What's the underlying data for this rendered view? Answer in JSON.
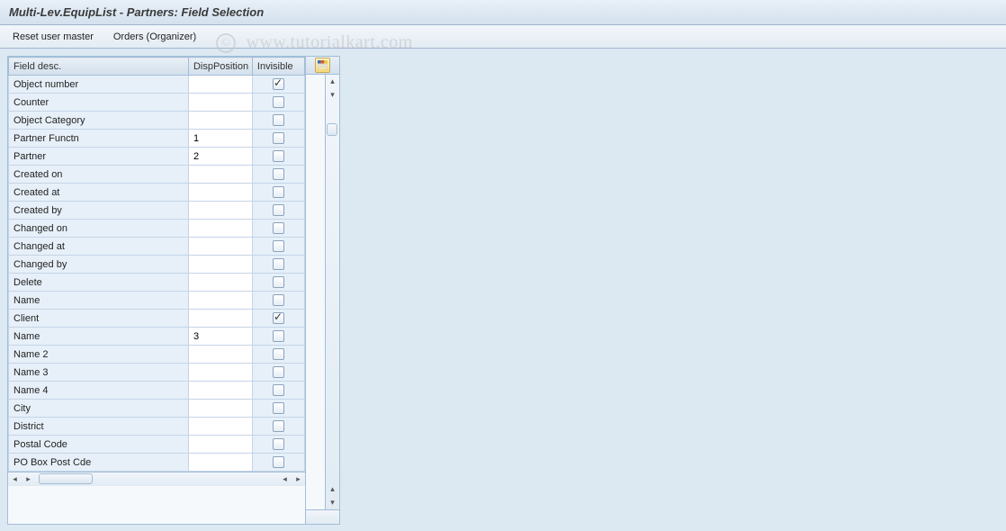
{
  "header": {
    "title": "Multi-Lev.EquipList - Partners: Field Selection"
  },
  "toolbar": {
    "reset_label": "Reset user master",
    "orders_label": "Orders (Organizer)"
  },
  "watermark": {
    "symbol": "©",
    "text": "www.tutorialkart.com"
  },
  "table": {
    "columns": {
      "field_desc": "Field desc.",
      "disp_position": "DispPosition",
      "invisible": "Invisible"
    },
    "rows": [
      {
        "field": "Object number",
        "disp": "",
        "invisible": true
      },
      {
        "field": "Counter",
        "disp": "",
        "invisible": false
      },
      {
        "field": "Object Category",
        "disp": "",
        "invisible": false
      },
      {
        "field": "Partner Functn",
        "disp": "1",
        "invisible": false
      },
      {
        "field": "Partner",
        "disp": "2",
        "invisible": false
      },
      {
        "field": "Created on",
        "disp": "",
        "invisible": false
      },
      {
        "field": "Created at",
        "disp": "",
        "invisible": false
      },
      {
        "field": "Created by",
        "disp": "",
        "invisible": false
      },
      {
        "field": "Changed on",
        "disp": "",
        "invisible": false
      },
      {
        "field": "Changed at",
        "disp": "",
        "invisible": false
      },
      {
        "field": "Changed by",
        "disp": "",
        "invisible": false
      },
      {
        "field": "Delete",
        "disp": "",
        "invisible": false
      },
      {
        "field": "Name",
        "disp": "",
        "invisible": false
      },
      {
        "field": "Client",
        "disp": "",
        "invisible": true
      },
      {
        "field": "Name",
        "disp": "3",
        "invisible": false
      },
      {
        "field": "Name 2",
        "disp": "",
        "invisible": false
      },
      {
        "field": "Name 3",
        "disp": "",
        "invisible": false
      },
      {
        "field": "Name 4",
        "disp": "",
        "invisible": false
      },
      {
        "field": "City",
        "disp": "",
        "invisible": false
      },
      {
        "field": "District",
        "disp": "",
        "invisible": false
      },
      {
        "field": "Postal Code",
        "disp": "",
        "invisible": false
      },
      {
        "field": "PO Box Post Cde",
        "disp": "",
        "invisible": false
      }
    ]
  }
}
